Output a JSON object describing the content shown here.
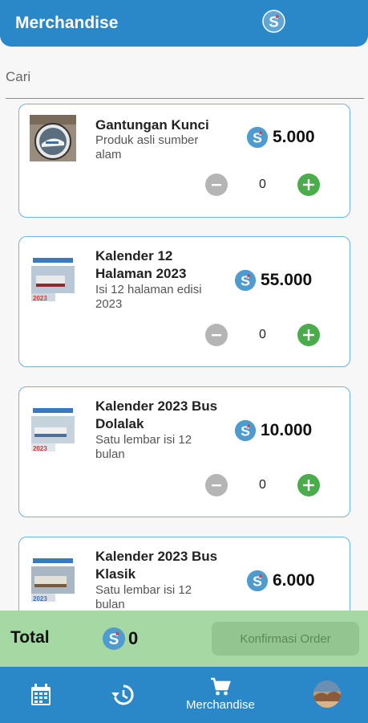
{
  "header": {
    "title": "Merchandise",
    "logo_icon": "s-coin-logo-icon"
  },
  "search": {
    "placeholder": "Cari",
    "value": ""
  },
  "currency_icon": "s-coin-icon",
  "products": [
    {
      "name": "Gantungan Kunci",
      "description": "Produk asli sumber alam",
      "price": "5.000",
      "quantity": "0"
    },
    {
      "name": "Kalender 12 Halaman 2023",
      "description": "Isi 12 halaman edisi 2023",
      "price": "55.000",
      "quantity": "0"
    },
    {
      "name": "Kalender 2023 Bus Dolalak",
      "description": "Satu lembar isi 12 bulan",
      "price": "10.000",
      "quantity": "0"
    },
    {
      "name": "Kalender 2023 Bus Klasik",
      "description": "Satu lembar isi 12 bulan",
      "price": "6.000"
    }
  ],
  "footer": {
    "total_label": "Total",
    "total_value": "0",
    "confirm_label": "Konfirmasi Order"
  },
  "nav": {
    "calendar_icon": "calendar-icon",
    "history_icon": "history-icon",
    "cart_icon": "cart-icon",
    "merch_label": "Merchandise",
    "profile": "avatar"
  },
  "colors": {
    "primary": "#2a87c8",
    "card_border": "#6fb4da",
    "plus": "#4aac4a",
    "minus": "#b5b5b5",
    "total_bar": "#a5d8a3",
    "confirm_disabled": "#93c590"
  }
}
